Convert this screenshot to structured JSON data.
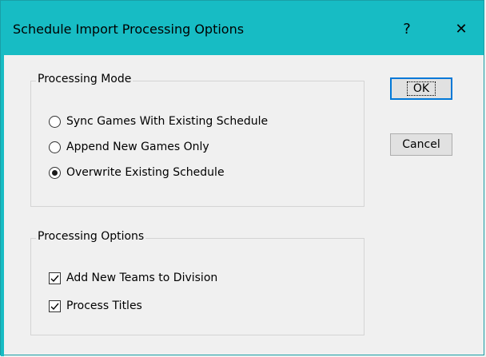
{
  "window": {
    "title": "Schedule Import Processing Options",
    "help_glyph": "?",
    "close_glyph": "✕",
    "accent_color": "#17bcc4"
  },
  "processing_mode": {
    "legend": "Processing Mode",
    "options": [
      {
        "label": "Sync Games With Existing Schedule",
        "selected": false
      },
      {
        "label": "Append New Games Only",
        "selected": false
      },
      {
        "label": "Overwrite Existing Schedule",
        "selected": true
      }
    ]
  },
  "processing_options": {
    "legend": "Processing Options",
    "options": [
      {
        "label": "Add New Teams to Division",
        "checked": true
      },
      {
        "label": "Process Titles",
        "checked": true
      }
    ]
  },
  "buttons": {
    "ok_label": "OK",
    "cancel_label": "Cancel"
  }
}
